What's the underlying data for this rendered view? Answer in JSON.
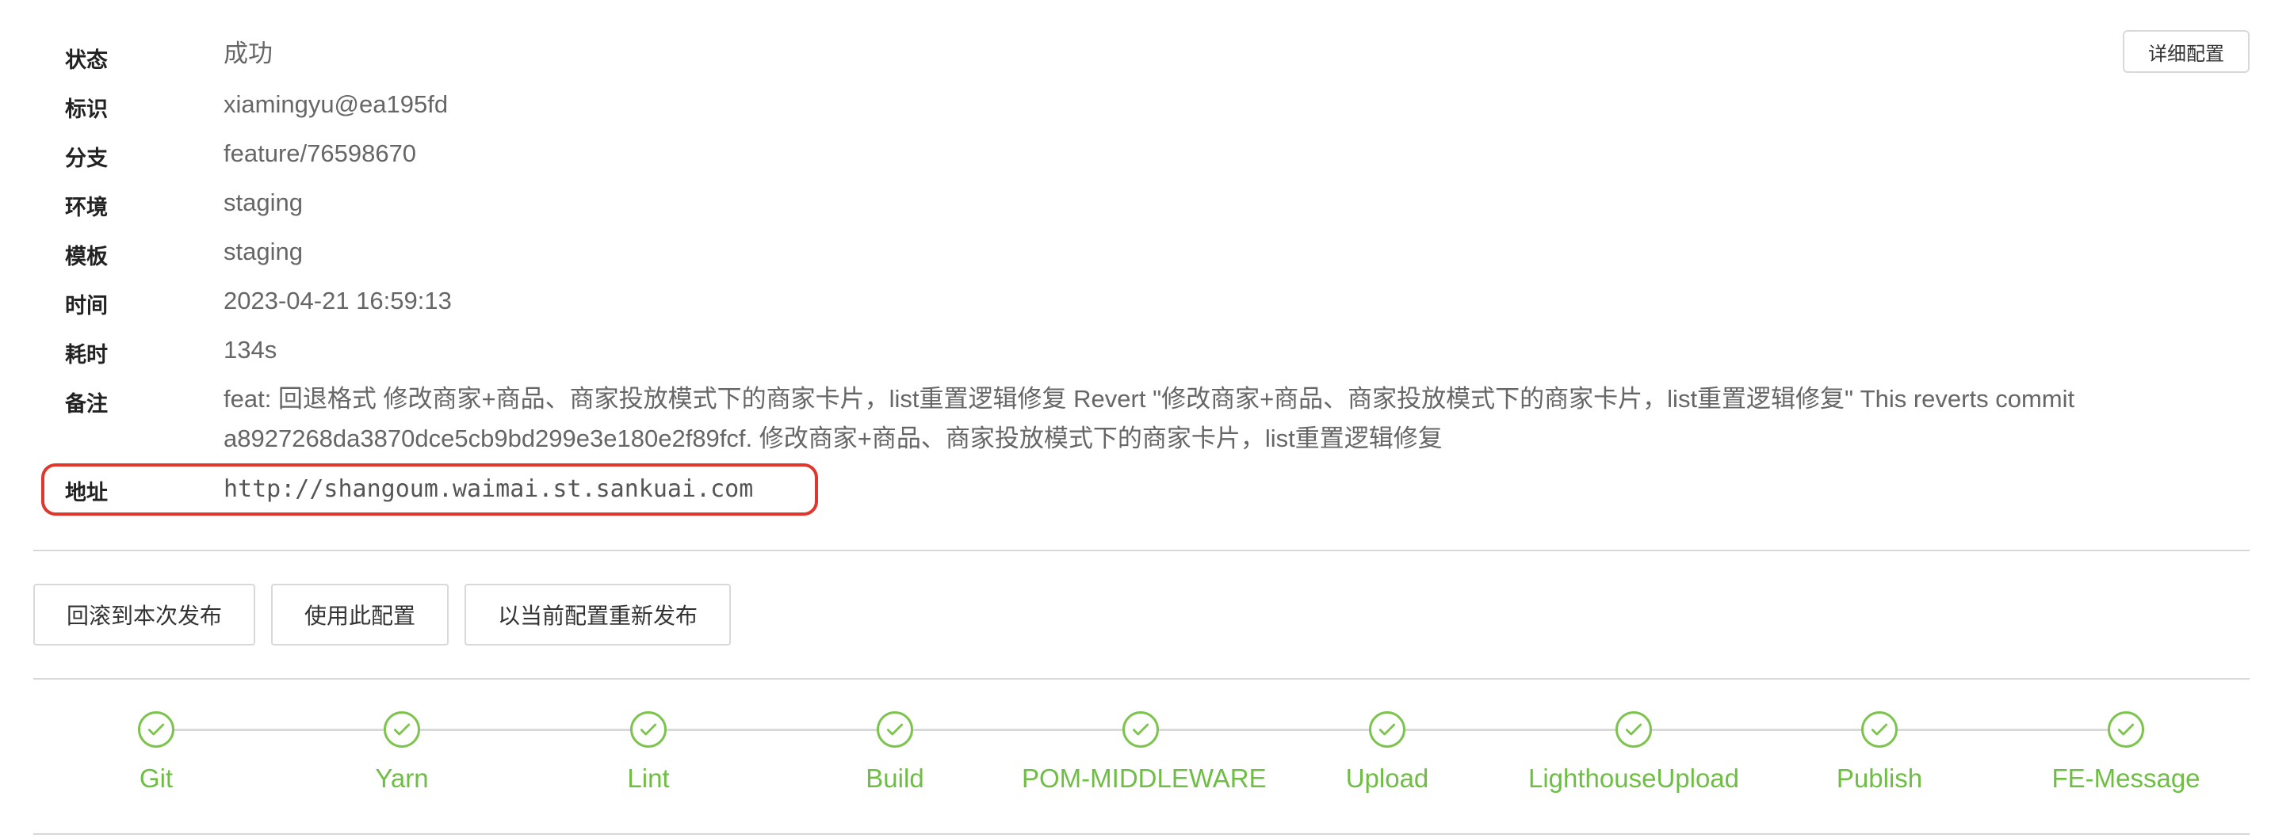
{
  "header": {
    "detail_button": "详细配置"
  },
  "info": [
    {
      "label": "状态",
      "value": "成功"
    },
    {
      "label": "标识",
      "value": "xiamingyu@ea195fd"
    },
    {
      "label": "分支",
      "value": "feature/76598670"
    },
    {
      "label": "环境",
      "value": "staging"
    },
    {
      "label": "模板",
      "value": "staging"
    },
    {
      "label": "时间",
      "value": "2023-04-21 16:59:13"
    },
    {
      "label": "耗时",
      "value": "134s"
    },
    {
      "label": "备注",
      "value_line1": "feat: 回退格式 修改商家+商品、商家投放模式下的商家卡片，list重置逻辑修复 Revert \"修改商家+商品、商家投放模式下的商家卡片，list重置逻辑修复\" This reverts commit",
      "value_line2": "a8927268da3870dce5cb9bd299e3e180e2f89fcf. 修改商家+商品、商家投放模式下的商家卡片，list重置逻辑修复"
    },
    {
      "label": "地址",
      "value": "http://shangoum.waimai.st.sankuai.com"
    }
  ],
  "actions": {
    "rollback": "回滚到本次发布",
    "use_config": "使用此配置",
    "republish": "以当前配置重新发布"
  },
  "pipeline": {
    "status_color": "#6fbe44",
    "steps": [
      {
        "label": "Git",
        "status": "success"
      },
      {
        "label": "Yarn",
        "status": "success"
      },
      {
        "label": "Lint",
        "status": "success"
      },
      {
        "label": "Build",
        "status": "success"
      },
      {
        "label": "POM-MIDDLEWARE",
        "status": "success"
      },
      {
        "label": "Upload",
        "status": "success"
      },
      {
        "label": "LighthouseUpload",
        "status": "success"
      },
      {
        "label": "Publish",
        "status": "success"
      },
      {
        "label": "FE-Message",
        "status": "success"
      }
    ]
  }
}
